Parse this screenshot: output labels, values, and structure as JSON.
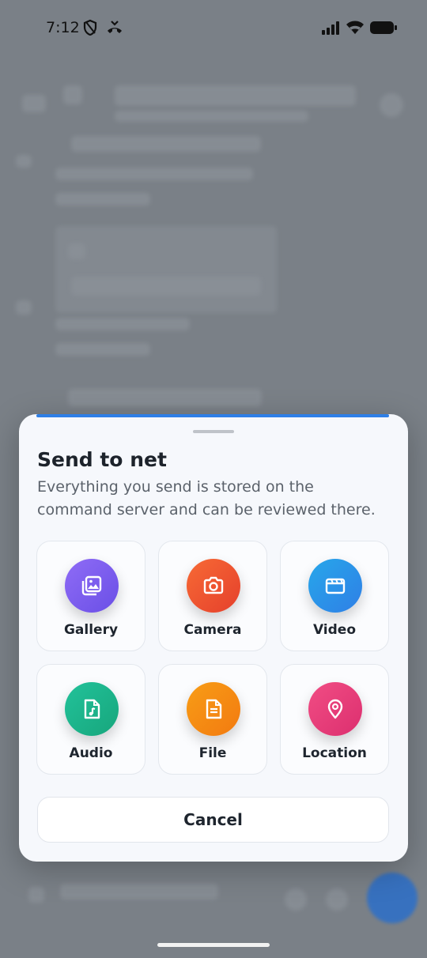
{
  "status_bar": {
    "time": "7:12"
  },
  "sheet": {
    "title": "Send to net",
    "subtitle": "Everything you send is stored on the command server and can be reviewed there.",
    "options": [
      {
        "label": "Gallery",
        "icon": "gallery-icon",
        "color": "#7b5cf0"
      },
      {
        "label": "Camera",
        "icon": "camera-icon",
        "color": "#f0522f"
      },
      {
        "label": "Video",
        "icon": "video-icon",
        "color": "#2a8fe6"
      },
      {
        "label": "Audio",
        "icon": "audio-icon",
        "color": "#1fb489"
      },
      {
        "label": "File",
        "icon": "file-icon",
        "color": "#f58a12"
      },
      {
        "label": "Location",
        "icon": "location-icon",
        "color": "#ea3d7c"
      }
    ],
    "cancel_label": "Cancel"
  },
  "colors": {
    "accent": "#2f7fe6",
    "sheet_background": "#f6f8fc"
  }
}
